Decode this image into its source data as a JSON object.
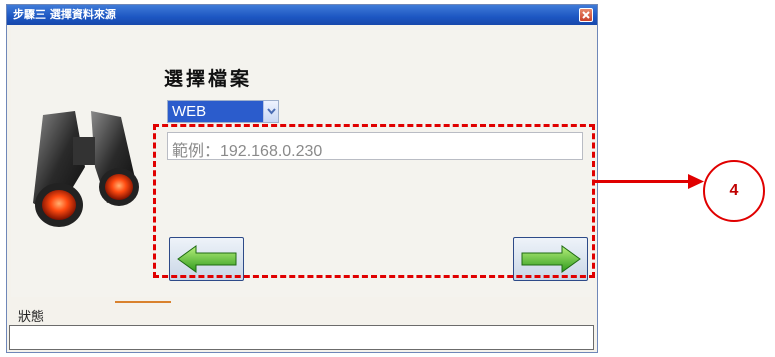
{
  "window": {
    "title": "步驟三 選擇資料來源"
  },
  "main": {
    "heading": "選擇檔案",
    "source_select": {
      "selected": "WEB"
    },
    "address_input": {
      "placeholder": "範例：192.168.0.230"
    }
  },
  "status": {
    "label": "狀態",
    "value": ""
  },
  "annotation": {
    "number": "4",
    "color": "#e00000"
  },
  "icons": {
    "logo": "binoculars-icon",
    "prev": "left-arrow-icon",
    "next": "right-arrow-icon",
    "close": "close-icon",
    "dropdown": "chevron-down-icon"
  }
}
